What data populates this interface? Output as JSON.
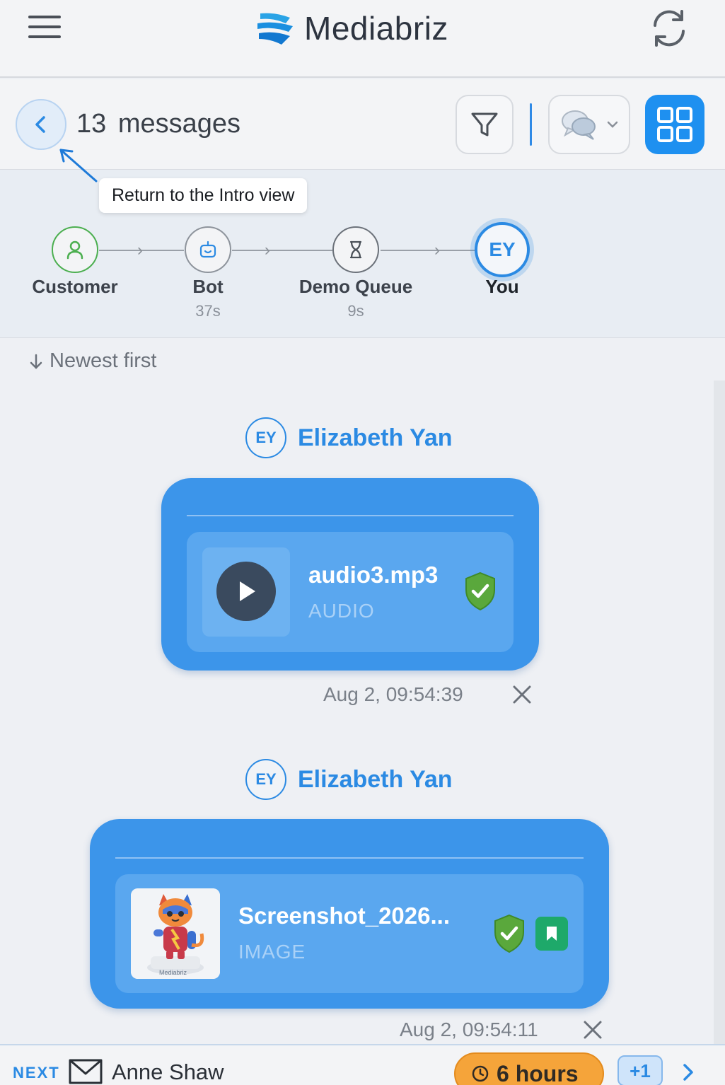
{
  "header": {
    "brand_name": "Mediabriz"
  },
  "subheader": {
    "message_count": "13",
    "message_count_label": "messages"
  },
  "tooltip": {
    "text": "Return to the Intro view"
  },
  "journey": {
    "steps": [
      {
        "label": "Customer",
        "sub": ""
      },
      {
        "label": "Bot",
        "sub": "37s"
      },
      {
        "label": "Demo Queue",
        "sub": "9s"
      },
      {
        "label": "You",
        "sub": "",
        "initials": "EY"
      }
    ]
  },
  "sort": {
    "label": "Newest first"
  },
  "messages": [
    {
      "sender_initials": "EY",
      "sender_name": "Elizabeth Yan",
      "file_name": "audio3.mp3",
      "file_type": "AUDIO",
      "time": "Aug 2, 09:54:39"
    },
    {
      "sender_initials": "EY",
      "sender_name": "Elizabeth Yan",
      "file_name": "Screenshot_2026...",
      "file_type": "IMAGE",
      "time": "Aug 2, 09:54:11",
      "thumb_watermark": "Mediabriz"
    }
  ],
  "bottom": {
    "next_label": "NEXT",
    "next_name": "Anne Shaw",
    "timer": "6 hours",
    "extra_count": "+1"
  },
  "colors": {
    "accent": "#1e90f0",
    "bubble": "#3c95ea",
    "customer": "#4caf50",
    "timer": "#f5a43a"
  }
}
